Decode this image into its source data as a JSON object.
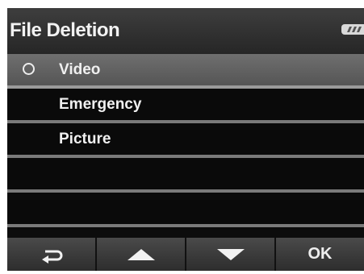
{
  "header": {
    "title": "File Deletion",
    "battery_icon": "battery-icon"
  },
  "menu": {
    "items": [
      {
        "label": "Video",
        "selected": true
      },
      {
        "label": "Emergency",
        "selected": false
      },
      {
        "label": "Picture",
        "selected": false
      },
      {
        "label": "",
        "selected": false
      },
      {
        "label": "",
        "selected": false
      }
    ]
  },
  "toolbar": {
    "back_icon": "return-arrow-icon",
    "up_icon": "up-arrow-icon",
    "down_icon": "down-arrow-icon",
    "ok_label": "OK"
  },
  "colors": {
    "background": "#0c0c0c",
    "selected_row": "#666666",
    "separator": "#7a7a7a",
    "text": "#f0f0f0"
  }
}
